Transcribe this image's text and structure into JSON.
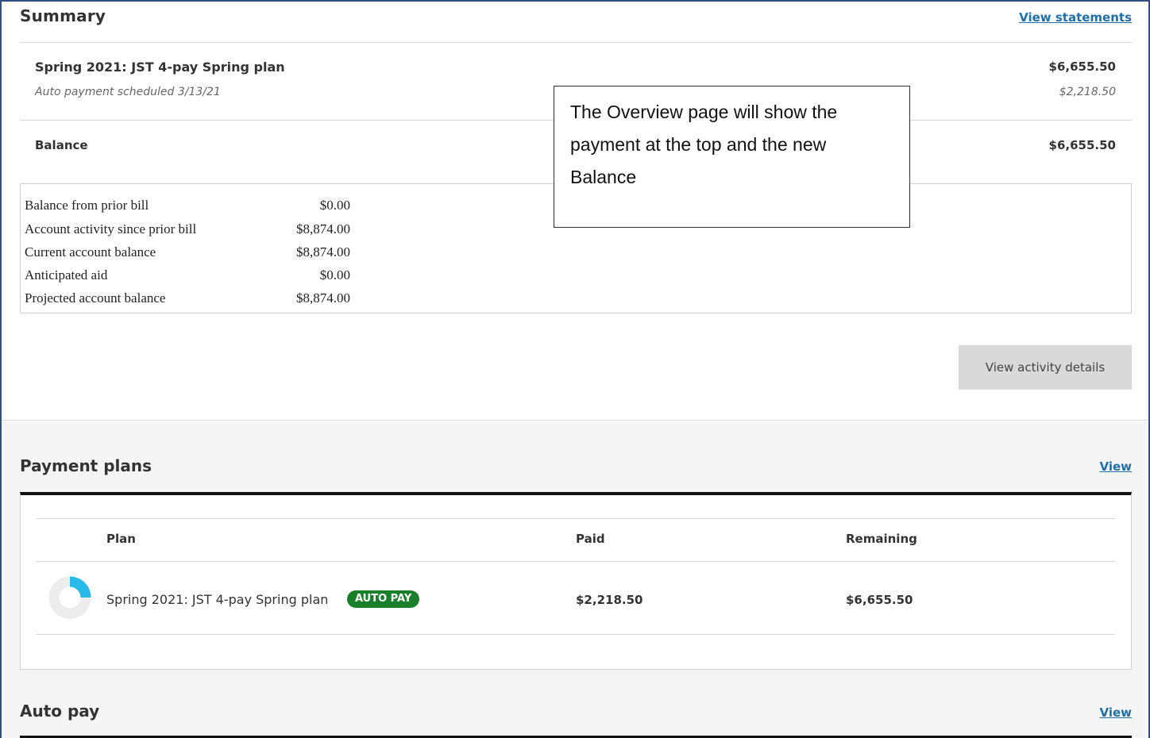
{
  "summary": {
    "title": "Summary",
    "view_statements": "View statements",
    "plan": {
      "name": "Spring 2021: JST 4-pay Spring plan",
      "amount": "$6,655.50",
      "scheduled": "Auto payment scheduled 3/13/21",
      "scheduled_amount": "$2,218.50"
    },
    "balance_label": "Balance",
    "balance_amount": "$6,655.50",
    "bill_rows": [
      {
        "label": "Balance from prior bill",
        "value": "$0.00"
      },
      {
        "label": "Account activity since prior bill",
        "value": "$8,874.00"
      },
      {
        "label": "Current account balance",
        "value": "$8,874.00"
      },
      {
        "label": "Anticipated aid",
        "value": "$0.00"
      },
      {
        "label": "Projected account balance",
        "value": "$8,874.00"
      }
    ],
    "activity_button": "View activity details"
  },
  "callout": {
    "text": "The Overview page will show the payment at the top and the new Balance"
  },
  "payment_plans": {
    "title": "Payment plans",
    "view": "View",
    "columns": {
      "plan": "Plan",
      "paid": "Paid",
      "remaining": "Remaining"
    },
    "rows": [
      {
        "name": "Spring 2021: JST 4-pay Spring plan",
        "badge": "AUTO PAY",
        "paid": "$2,218.50",
        "remaining": "$6,655.50",
        "progress_fraction": 0.25
      }
    ]
  },
  "auto_pay": {
    "title": "Auto pay",
    "view": "View"
  },
  "colors": {
    "link": "#1f6fa8",
    "badge_green": "#1a7f2a",
    "progress_cyan": "#29b9e8",
    "progress_track": "#ececec"
  }
}
